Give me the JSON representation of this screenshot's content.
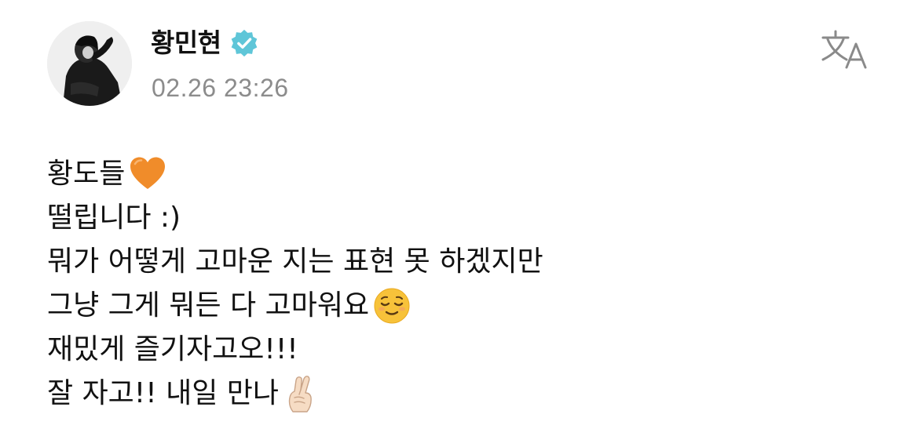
{
  "author": {
    "name": "황민현",
    "verified": true,
    "avatar_icon": "profile-photo",
    "verified_icon": "verified-badge-icon",
    "verified_color": "#5fc6d8"
  },
  "post": {
    "timestamp": "02.26 23:26",
    "lines": [
      {
        "text": "황도들",
        "emoji": "orange-heart"
      },
      {
        "text": "떨립니다 :)",
        "emoji": null
      },
      {
        "text": "뭐가 어떻게 고마운 지는 표현 못 하겠지만",
        "emoji": null
      },
      {
        "text": "그냥 그게 뭐든 다 고마워요",
        "emoji": "relieved-face"
      },
      {
        "text": "재밌게 즐기자고오!!!",
        "emoji": null
      },
      {
        "text": "잘 자고!! 내일 만나",
        "emoji": "crossed-fingers-light-skin"
      }
    ]
  },
  "toolbar": {
    "translate_icon": "translate-icon"
  },
  "colors": {
    "text": "#111111",
    "timestamp": "#8c8c8c",
    "icon": "#888888",
    "heart": "#f08c2a",
    "face": "#f7c23a"
  }
}
